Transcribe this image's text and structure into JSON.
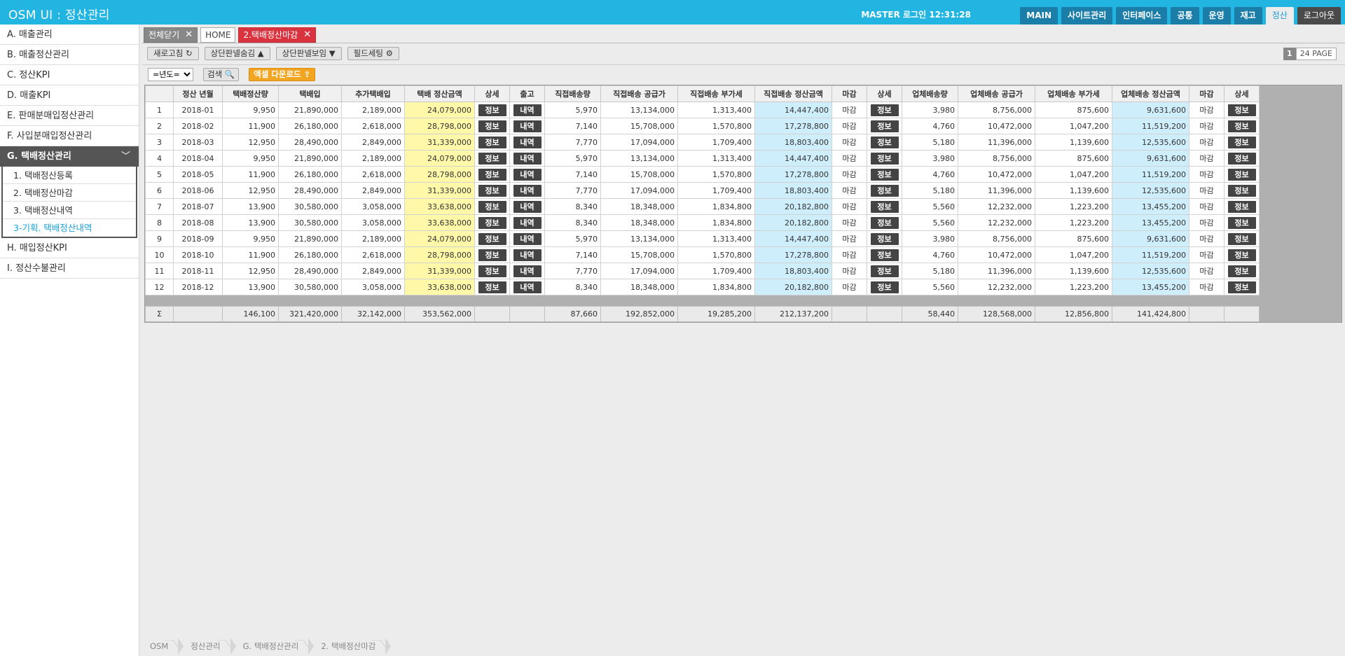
{
  "header": {
    "title": "OSM UI : 정산관리",
    "login_info": "MASTER 로그인 12:31:28",
    "nav": [
      "MAIN",
      "사이트관리",
      "인터페이스",
      "공통",
      "운영",
      "재고",
      "정산",
      "로그아웃"
    ],
    "active_nav": "정산"
  },
  "sidebar": {
    "items_top": [
      "A. 매출관리",
      "B. 매출정산관리",
      "C. 정산KPI",
      "D. 매출KPI",
      "E. 판매분매입정산관리",
      "F. 사입분매입정산관리"
    ],
    "expanded": "G. 택배정산관리",
    "submenu": [
      "1. 택배정산등록",
      "2. 택배정산마감",
      "3. 택배정산내역",
      "3-기획. 택배정산내역"
    ],
    "items_bottom": [
      "H. 매입정산KPI",
      "I. 정산수불관리"
    ]
  },
  "tabs": {
    "close_all": "전체닫기",
    "home": "HOME",
    "active": "2.택배정산마감",
    "close_glyph": "✕"
  },
  "toolbar": {
    "refresh": "새로고침 ↻",
    "hide_panel": "상단판넬숨김 ▲",
    "show_panel": "상단판넬보임 ▼",
    "field_setting": "필드세팅 ⚙",
    "page_current": "1",
    "page_total": "24 PAGE"
  },
  "filter": {
    "year_option": "=년도=",
    "search": "검색 🔍",
    "excel": "엑셀 다운로드 ⇪"
  },
  "table": {
    "headers": [
      "",
      "정산 년월",
      "택배정산량",
      "택배입",
      "추가택배입",
      "택배 정산금액",
      "상세",
      "출고",
      "직접배송량",
      "직접배송 공급가",
      "직접배송 부가세",
      "직접배송 정산금액",
      "마감",
      "상세",
      "업체배송량",
      "업체배송 공급가",
      "업체배송 부가세",
      "업체배송 정산금액",
      "마감",
      "상세"
    ],
    "info_btn": "정보",
    "history_btn": "내역",
    "close_label": "마감",
    "rows": [
      [
        "1",
        "2018-01",
        "9,950",
        "21,890,000",
        "2,189,000",
        "24,079,000",
        "5,970",
        "13,134,000",
        "1,313,400",
        "14,447,400",
        "3,980",
        "8,756,000",
        "875,600",
        "9,631,600"
      ],
      [
        "2",
        "2018-02",
        "11,900",
        "26,180,000",
        "2,618,000",
        "28,798,000",
        "7,140",
        "15,708,000",
        "1,570,800",
        "17,278,800",
        "4,760",
        "10,472,000",
        "1,047,200",
        "11,519,200"
      ],
      [
        "3",
        "2018-03",
        "12,950",
        "28,490,000",
        "2,849,000",
        "31,339,000",
        "7,770",
        "17,094,000",
        "1,709,400",
        "18,803,400",
        "5,180",
        "11,396,000",
        "1,139,600",
        "12,535,600"
      ],
      [
        "4",
        "2018-04",
        "9,950",
        "21,890,000",
        "2,189,000",
        "24,079,000",
        "5,970",
        "13,134,000",
        "1,313,400",
        "14,447,400",
        "3,980",
        "8,756,000",
        "875,600",
        "9,631,600"
      ],
      [
        "5",
        "2018-05",
        "11,900",
        "26,180,000",
        "2,618,000",
        "28,798,000",
        "7,140",
        "15,708,000",
        "1,570,800",
        "17,278,800",
        "4,760",
        "10,472,000",
        "1,047,200",
        "11,519,200"
      ],
      [
        "6",
        "2018-06",
        "12,950",
        "28,490,000",
        "2,849,000",
        "31,339,000",
        "7,770",
        "17,094,000",
        "1,709,400",
        "18,803,400",
        "5,180",
        "11,396,000",
        "1,139,600",
        "12,535,600"
      ],
      [
        "7",
        "2018-07",
        "13,900",
        "30,580,000",
        "3,058,000",
        "33,638,000",
        "8,340",
        "18,348,000",
        "1,834,800",
        "20,182,800",
        "5,560",
        "12,232,000",
        "1,223,200",
        "13,455,200"
      ],
      [
        "8",
        "2018-08",
        "13,900",
        "30,580,000",
        "3,058,000",
        "33,638,000",
        "8,340",
        "18,348,000",
        "1,834,800",
        "20,182,800",
        "5,560",
        "12,232,000",
        "1,223,200",
        "13,455,200"
      ],
      [
        "9",
        "2018-09",
        "9,950",
        "21,890,000",
        "2,189,000",
        "24,079,000",
        "5,970",
        "13,134,000",
        "1,313,400",
        "14,447,400",
        "3,980",
        "8,756,000",
        "875,600",
        "9,631,600"
      ],
      [
        "10",
        "2018-10",
        "11,900",
        "26,180,000",
        "2,618,000",
        "28,798,000",
        "7,140",
        "15,708,000",
        "1,570,800",
        "17,278,800",
        "4,760",
        "10,472,000",
        "1,047,200",
        "11,519,200"
      ],
      [
        "11",
        "2018-11",
        "12,950",
        "28,490,000",
        "2,849,000",
        "31,339,000",
        "7,770",
        "17,094,000",
        "1,709,400",
        "18,803,400",
        "5,180",
        "11,396,000",
        "1,139,600",
        "12,535,600"
      ],
      [
        "12",
        "2018-12",
        "13,900",
        "30,580,000",
        "3,058,000",
        "33,638,000",
        "8,340",
        "18,348,000",
        "1,834,800",
        "20,182,800",
        "5,560",
        "12,232,000",
        "1,223,200",
        "13,455,200"
      ]
    ],
    "summary": [
      "Σ",
      "",
      "146,100",
      "321,420,000",
      "32,142,000",
      "353,562,000",
      "",
      "",
      "87,660",
      "192,852,000",
      "19,285,200",
      "212,137,200",
      "",
      "",
      "58,440",
      "128,568,000",
      "12,856,800",
      "141,424,800",
      "",
      ""
    ]
  },
  "breadcrumb": [
    "OSM",
    "정산관리",
    "G. 택배정산관리",
    "2. 택배정산마감"
  ],
  "colors": {
    "header_bg": "#22b5e2",
    "nav_bg": "#1a7ea9",
    "active_tab": "#d9333f",
    "excel_btn": "#f1a521",
    "highlight_yellow": "#fff8a8",
    "highlight_blue": "#cfeefb"
  }
}
